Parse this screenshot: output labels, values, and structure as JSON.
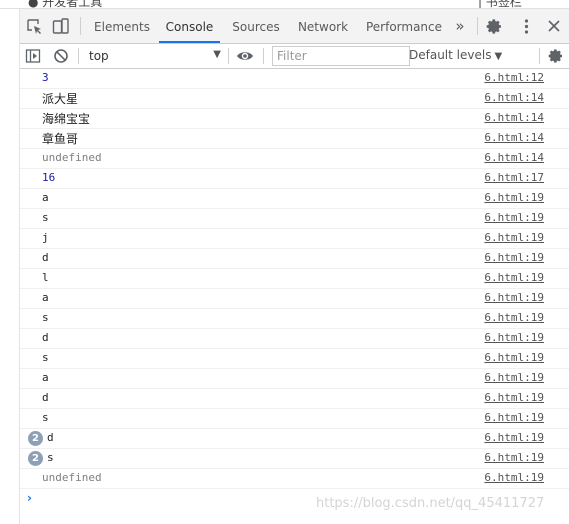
{
  "top_fragment": {
    "left": "● 开发者工具",
    "right": "| 书签栏"
  },
  "tabs": [
    {
      "label": "Elements",
      "active": false
    },
    {
      "label": "Console",
      "active": true
    },
    {
      "label": "Sources",
      "active": false
    },
    {
      "label": "Network",
      "active": false
    },
    {
      "label": "Performance",
      "active": false
    }
  ],
  "tab_overflow": "»",
  "toolbar": {
    "context": "top",
    "filter_placeholder": "Filter",
    "levels_label": "Default levels"
  },
  "console": [
    {
      "text": "3",
      "kind": "num",
      "source": "6.html:12"
    },
    {
      "text": "派大星",
      "kind": "cjk",
      "source": "6.html:14"
    },
    {
      "text": "海绵宝宝",
      "kind": "cjk",
      "source": "6.html:14"
    },
    {
      "text": "章鱼哥",
      "kind": "cjk",
      "source": "6.html:14"
    },
    {
      "text": "undefined",
      "kind": "undef",
      "source": "6.html:14"
    },
    {
      "text": "16",
      "kind": "num",
      "source": "6.html:17"
    },
    {
      "text": "a",
      "kind": "str",
      "source": "6.html:19"
    },
    {
      "text": "s",
      "kind": "str",
      "source": "6.html:19"
    },
    {
      "text": "j",
      "kind": "str",
      "source": "6.html:19"
    },
    {
      "text": "d",
      "kind": "str",
      "source": "6.html:19"
    },
    {
      "text": "l",
      "kind": "str",
      "source": "6.html:19"
    },
    {
      "text": "a",
      "kind": "str",
      "source": "6.html:19"
    },
    {
      "text": "s",
      "kind": "str",
      "source": "6.html:19"
    },
    {
      "text": "d",
      "kind": "str",
      "source": "6.html:19"
    },
    {
      "text": "s",
      "kind": "str",
      "source": "6.html:19"
    },
    {
      "text": "a",
      "kind": "str",
      "source": "6.html:19"
    },
    {
      "text": "d",
      "kind": "str",
      "source": "6.html:19"
    },
    {
      "text": "s",
      "kind": "str",
      "source": "6.html:19"
    },
    {
      "text": "d",
      "kind": "str",
      "source": "6.html:19",
      "count": "2"
    },
    {
      "text": "s",
      "kind": "str",
      "source": "6.html:19",
      "count": "2"
    },
    {
      "text": "undefined",
      "kind": "undef",
      "source": "6.html:19"
    }
  ],
  "prompt_symbol": "›",
  "watermark": "https://blog.csdn.net/qq_45411727"
}
